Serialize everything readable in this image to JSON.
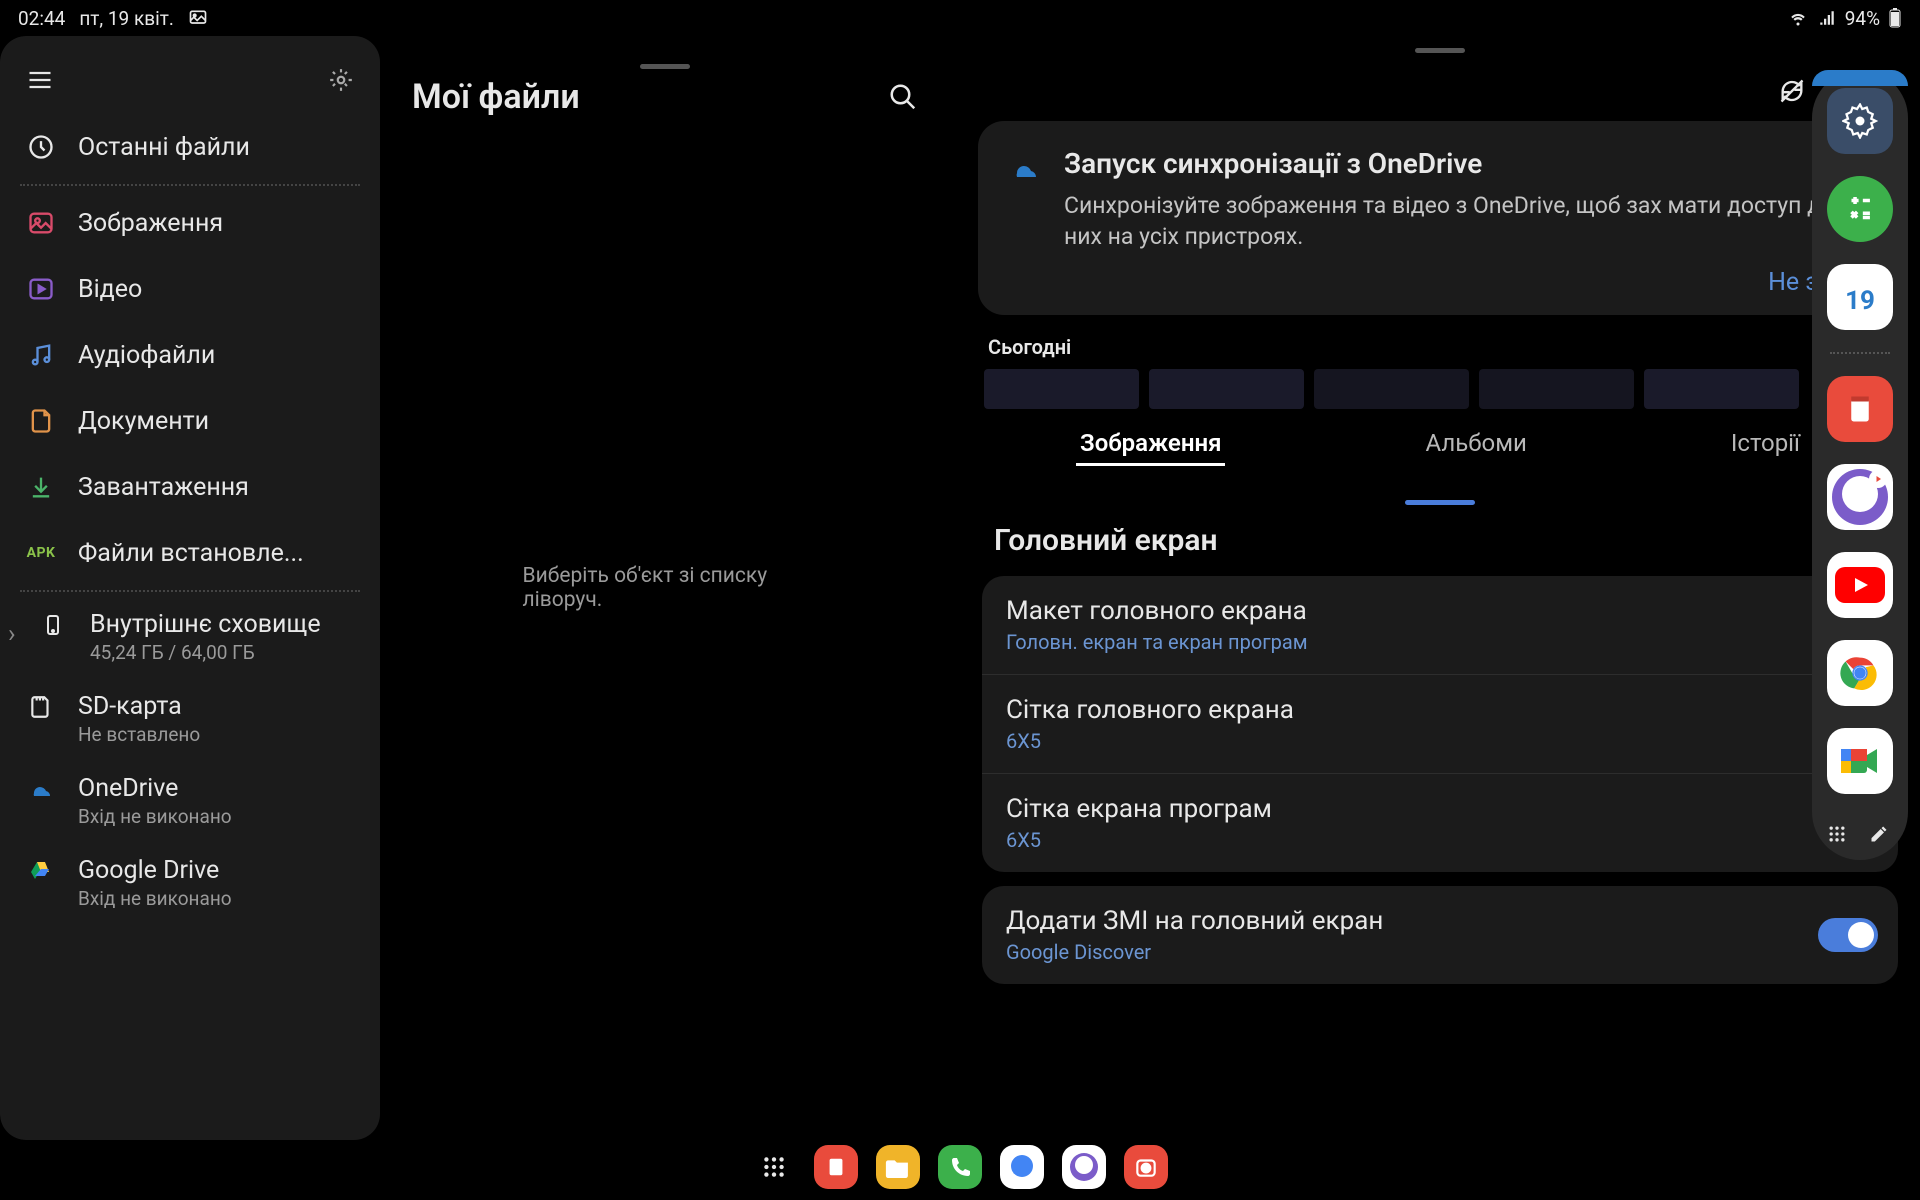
{
  "status": {
    "time": "02:44",
    "date": "пт, 19 квіт.",
    "battery": "94%"
  },
  "files": {
    "title": "Мої файли",
    "placeholder": "Виберіть об'єкт зі списку ліворуч.",
    "sidebar": {
      "recent": "Останні файли",
      "images": "Зображення",
      "video": "Відео",
      "audio": "Аудіофайли",
      "documents": "Документи",
      "downloads": "Завантаження",
      "apk": "Файли встановле...",
      "internal": {
        "label": "Внутрішнє сховище",
        "sub": "45,24 ГБ / 64,00 ГБ"
      },
      "sdcard": {
        "label": "SD-карта",
        "sub": "Не вставлено"
      },
      "onedrive": {
        "label": "OneDrive",
        "sub": "Вхід не виконано"
      },
      "gdrive": {
        "label": "Google Drive",
        "sub": "Вхід не виконано"
      }
    }
  },
  "gallery": {
    "onedrive": {
      "title": "Запуск синхронізації з OneDrive",
      "desc": "Синхронізуйте зображення та відео з OneDrive, щоб зах мати доступ до них на усіх пристроях.",
      "dismiss": "Не зараз"
    },
    "today": "Сьогодні",
    "tabs": {
      "images": "Зображення",
      "albums": "Альбоми",
      "stories": "Історії"
    }
  },
  "home": {
    "title": "Головний екран",
    "items": {
      "layout": {
        "primary": "Макет головного екрана",
        "secondary": "Головн. екран та екран програм"
      },
      "grid": {
        "primary": "Сітка головного екрана",
        "secondary": "6X5"
      },
      "appgrid": {
        "primary": "Сітка екрана програм",
        "secondary": "6X5"
      },
      "media": {
        "primary": "Додати ЗМІ на головний екран",
        "secondary": "Google Discover"
      }
    }
  },
  "dock": {
    "calendar_day": "19"
  }
}
